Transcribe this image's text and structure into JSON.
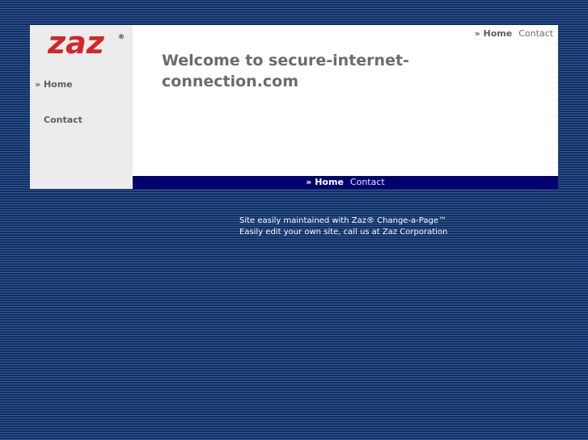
{
  "logo": {
    "text": "zaz",
    "registered": "®",
    "color": "#d2262b"
  },
  "nav": {
    "prefix": "» ",
    "home": "Home",
    "contact": "Contact"
  },
  "main": {
    "heading": "Welcome to secure-internet-connection.com"
  },
  "footer": {
    "line1": "Site easily maintained with Zaz® Change-a-Page™",
    "line2": "Easily edit your own site, call us at Zaz Corporation"
  },
  "colors": {
    "bar": "#00006e",
    "sidebar": "#ececec",
    "background": "#1c3a6e"
  }
}
